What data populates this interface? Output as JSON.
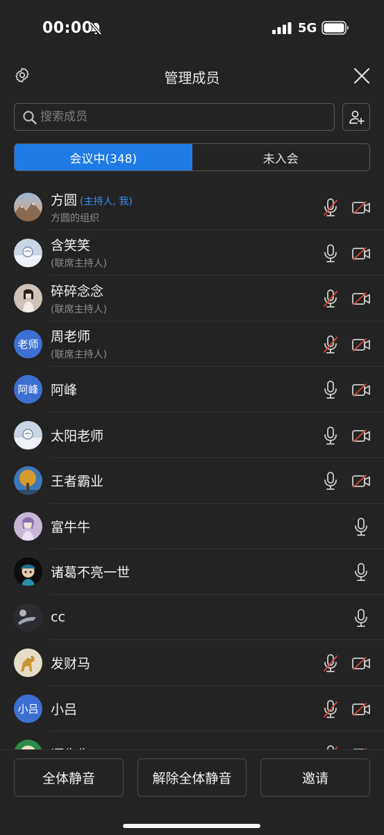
{
  "status_bar": {
    "time": "00:00",
    "network": "5G"
  },
  "header": {
    "title": "管理成员"
  },
  "search": {
    "placeholder": "搜索成员"
  },
  "tabs": [
    {
      "label": "会议中(348)",
      "active": true
    },
    {
      "label": "未入会",
      "active": false
    }
  ],
  "members": [
    {
      "name": "方圆",
      "tag": "(主持人, 我)",
      "sub": "方圆的组织",
      "avatar": "photo-mountain",
      "mic": "muted",
      "camera": "off"
    },
    {
      "name": "含笑笑",
      "tag": "",
      "sub": "(联席主持人)",
      "avatar": "photo-snow",
      "mic": "on",
      "camera": "off"
    },
    {
      "name": "碎碎念念",
      "tag": "",
      "sub": "(联席主持人)",
      "avatar": "photo-girl",
      "mic": "muted",
      "camera": "off"
    },
    {
      "name": "周老师",
      "tag": "",
      "sub": "(联席主持人)",
      "avatar_text": "老师",
      "mic": "muted",
      "camera": "off"
    },
    {
      "name": "阿峰",
      "tag": "",
      "sub": "",
      "avatar_text": "阿峰",
      "mic": "on",
      "camera": "off"
    },
    {
      "name": "太阳老师",
      "tag": "",
      "sub": "",
      "avatar": "photo-snow",
      "mic": "on",
      "camera": "off"
    },
    {
      "name": "王者霸业",
      "tag": "",
      "sub": "",
      "avatar": "photo-tree",
      "mic": "on",
      "camera": "off"
    },
    {
      "name": "富牛牛",
      "tag": "",
      "sub": "",
      "avatar": "photo-anime",
      "mic": "on",
      "camera": "none"
    },
    {
      "name": "诸葛不亮一世",
      "tag": "",
      "sub": "",
      "avatar": "photo-cartoon",
      "mic": "on",
      "camera": "none"
    },
    {
      "name": "cc",
      "tag": "",
      "sub": "",
      "avatar": "photo-dark",
      "mic": "on",
      "camera": "none"
    },
    {
      "name": "发财马",
      "tag": "",
      "sub": "",
      "avatar": "photo-horse",
      "mic": "muted",
      "camera": "off"
    },
    {
      "name": "小吕",
      "tag": "",
      "sub": "",
      "avatar_text": "小吕",
      "mic": "muted",
      "camera": "off"
    },
    {
      "name": "谭先生",
      "tag": "",
      "sub": "",
      "avatar": "photo-green",
      "mic": "muted",
      "camera": "off"
    }
  ],
  "actions": {
    "mute_all": "全体静音",
    "unmute_all": "解除全体静音",
    "invite": "邀请"
  },
  "colors": {
    "accent": "#1e7be6",
    "muted_slash": "#e0463a",
    "background": "#232323"
  }
}
